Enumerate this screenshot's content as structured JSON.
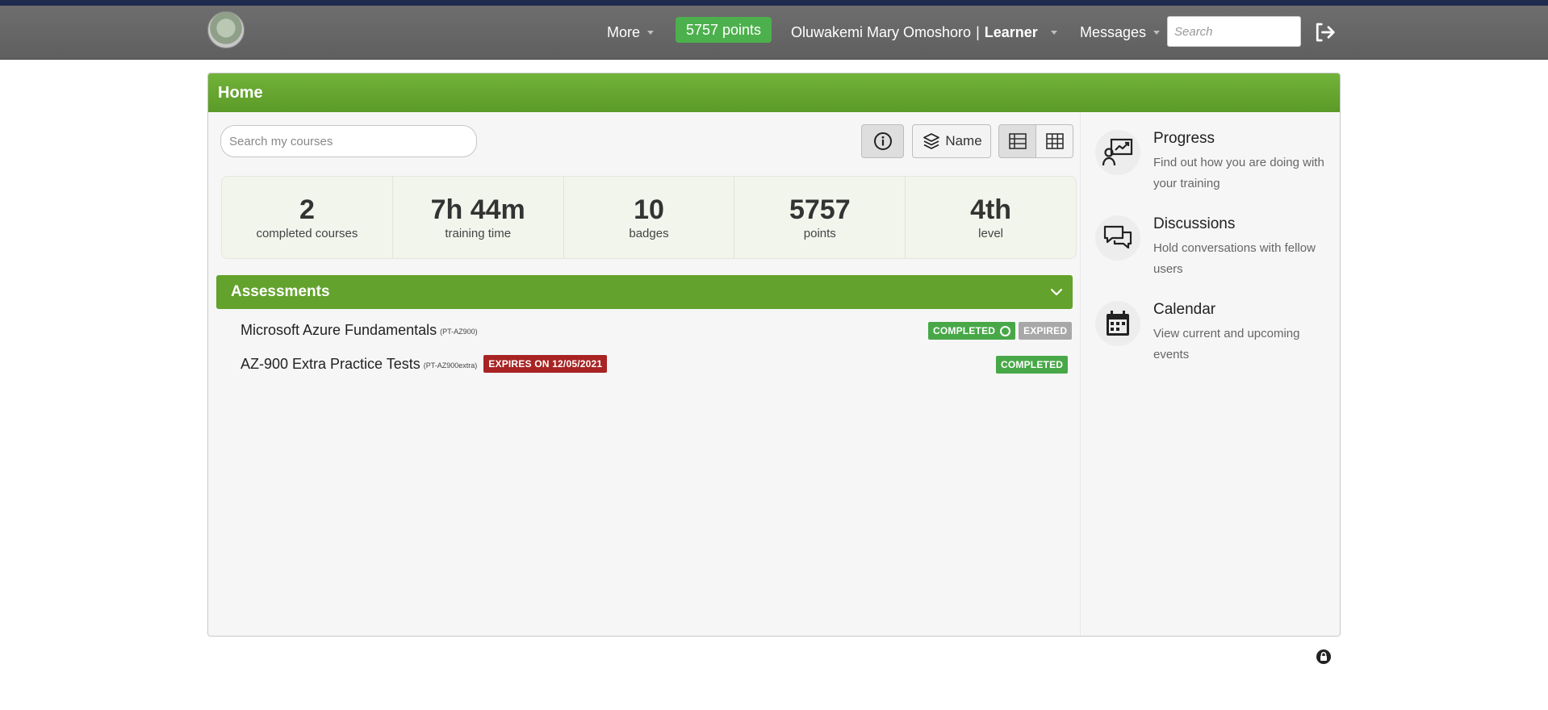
{
  "navbar": {
    "more_label": "More",
    "points_label": "5757 points",
    "user_name": "Oluwakemi Mary Omoshoro",
    "user_separator": "|",
    "user_role": "Learner",
    "messages_label": "Messages",
    "search_placeholder": "Search",
    "logo_icon": "organization-logo",
    "logout_icon": "sign-out-icon"
  },
  "page": {
    "title": "Home"
  },
  "toolbar": {
    "search_placeholder": "Search my courses",
    "sort_label": "Name",
    "info_icon": "info-icon",
    "sort_icon": "layers-icon",
    "list_view_icon": "list-view-icon",
    "grid_view_icon": "grid-view-icon"
  },
  "stats": [
    {
      "value": "2",
      "label": "completed courses"
    },
    {
      "value": "7h 44m",
      "label": "training time"
    },
    {
      "value": "10",
      "label": "badges"
    },
    {
      "value": "5757",
      "label": "points"
    },
    {
      "value": "4th",
      "label": "level"
    }
  ],
  "assessments": {
    "title": "Assessments",
    "items": [
      {
        "title": "Microsoft Azure Fundamentals",
        "code": "(PT-AZ900)",
        "badges": [
          "COMPLETED",
          "EXPIRED"
        ]
      },
      {
        "title": "AZ-900 Extra Practice Tests",
        "code": "(PT-AZ900extra)",
        "expiry_badge": "EXPIRES ON 12/05/2021",
        "badges": [
          "COMPLETED"
        ]
      }
    ]
  },
  "sidebar": [
    {
      "title": "Progress",
      "description": "Find out how you are doing with your training",
      "icon": "progress-chart-icon"
    },
    {
      "title": "Discussions",
      "description": "Hold conversations with fellow users",
      "icon": "chat-bubbles-icon"
    },
    {
      "title": "Calendar",
      "description": "View current and upcoming events",
      "icon": "calendar-icon"
    }
  ],
  "colors": {
    "navbar": "#666666",
    "header_green": "#63a22c",
    "points_green": "#4cb04c",
    "completed_green": "#48a848",
    "expired_gray": "#a8a8a8",
    "expires_red": "#a82323"
  }
}
